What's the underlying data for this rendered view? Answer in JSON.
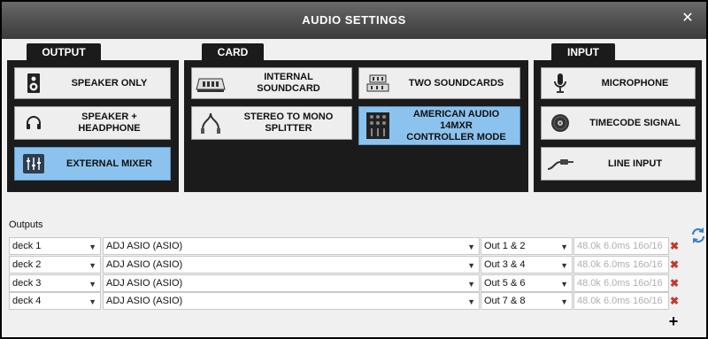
{
  "window": {
    "title": "AUDIO SETTINGS",
    "close_icon": "close-icon"
  },
  "output": {
    "tab": "OUTPUT",
    "buttons": [
      {
        "label": "SPEAKER ONLY",
        "icon": "speaker-icon",
        "selected": false
      },
      {
        "label": "SPEAKER +\nHEADPHONE",
        "icon": "headphone-icon",
        "selected": false
      },
      {
        "label": "EXTERNAL MIXER",
        "icon": "mixer-icon",
        "selected": true
      }
    ]
  },
  "card": {
    "tab": "CARD",
    "buttons": [
      {
        "label": "INTERNAL\nSOUNDCARD",
        "icon": "soundcard-icon",
        "selected": false
      },
      {
        "label": "TWO SOUNDCARDS",
        "icon": "two-soundcards-icon",
        "selected": false
      },
      {
        "label": "STEREO TO MONO\nSPLITTER",
        "icon": "splitter-cable-icon",
        "selected": false
      },
      {
        "label": "AMERICAN AUDIO\n14MXR\nCONTROLLER MODE",
        "icon": "controller-icon",
        "selected": true
      }
    ]
  },
  "input": {
    "tab": "INPUT",
    "buttons": [
      {
        "label": "MICROPHONE",
        "icon": "microphone-icon",
        "selected": false
      },
      {
        "label": "TIMECODE SIGNAL",
        "icon": "vinyl-icon",
        "selected": false
      },
      {
        "label": "LINE INPUT",
        "icon": "line-cable-icon",
        "selected": false
      }
    ]
  },
  "outputs": {
    "label": "Outputs",
    "rows": [
      {
        "deck": "deck 1",
        "device": "ADJ ASIO (ASIO)",
        "channels": "Out 1 & 2",
        "info": "48.0k 6.0ms 16o/16"
      },
      {
        "deck": "deck 2",
        "device": "ADJ ASIO (ASIO)",
        "channels": "Out 3 & 4",
        "info": "48.0k 6.0ms 16o/16"
      },
      {
        "deck": "deck 3",
        "device": "ADJ ASIO (ASIO)",
        "channels": "Out 5 & 6",
        "info": "48.0k 6.0ms 16o/16"
      },
      {
        "deck": "deck 4",
        "device": "ADJ ASIO (ASIO)",
        "channels": "Out 7 & 8",
        "info": "48.0k 6.0ms 16o/16"
      }
    ],
    "add_label": "+",
    "delete_label": "✖",
    "dropdown_arrow": "▼"
  },
  "colors": {
    "selected": "#8cc3ee",
    "panel": "#1b1b1b",
    "titlebar": "#555555"
  }
}
